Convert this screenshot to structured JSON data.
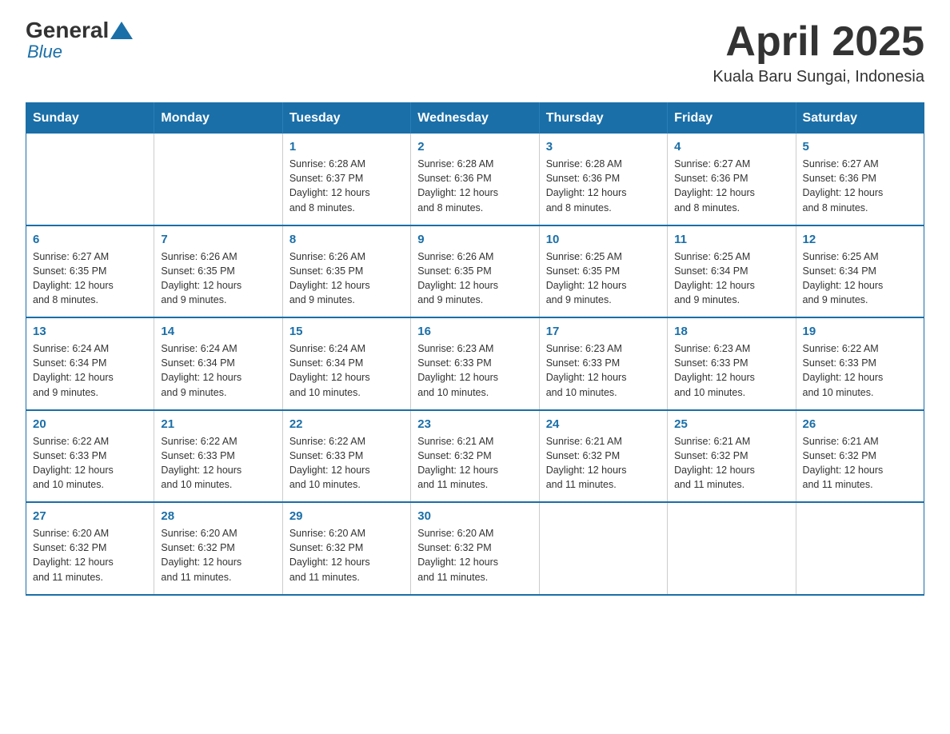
{
  "logo": {
    "general": "General",
    "blue": "Blue"
  },
  "title": "April 2025",
  "subtitle": "Kuala Baru Sungai, Indonesia",
  "weekdays": [
    "Sunday",
    "Monday",
    "Tuesday",
    "Wednesday",
    "Thursday",
    "Friday",
    "Saturday"
  ],
  "weeks": [
    [
      {
        "day": "",
        "info": ""
      },
      {
        "day": "",
        "info": ""
      },
      {
        "day": "1",
        "info": "Sunrise: 6:28 AM\nSunset: 6:37 PM\nDaylight: 12 hours\nand 8 minutes."
      },
      {
        "day": "2",
        "info": "Sunrise: 6:28 AM\nSunset: 6:36 PM\nDaylight: 12 hours\nand 8 minutes."
      },
      {
        "day": "3",
        "info": "Sunrise: 6:28 AM\nSunset: 6:36 PM\nDaylight: 12 hours\nand 8 minutes."
      },
      {
        "day": "4",
        "info": "Sunrise: 6:27 AM\nSunset: 6:36 PM\nDaylight: 12 hours\nand 8 minutes."
      },
      {
        "day": "5",
        "info": "Sunrise: 6:27 AM\nSunset: 6:36 PM\nDaylight: 12 hours\nand 8 minutes."
      }
    ],
    [
      {
        "day": "6",
        "info": "Sunrise: 6:27 AM\nSunset: 6:35 PM\nDaylight: 12 hours\nand 8 minutes."
      },
      {
        "day": "7",
        "info": "Sunrise: 6:26 AM\nSunset: 6:35 PM\nDaylight: 12 hours\nand 9 minutes."
      },
      {
        "day": "8",
        "info": "Sunrise: 6:26 AM\nSunset: 6:35 PM\nDaylight: 12 hours\nand 9 minutes."
      },
      {
        "day": "9",
        "info": "Sunrise: 6:26 AM\nSunset: 6:35 PM\nDaylight: 12 hours\nand 9 minutes."
      },
      {
        "day": "10",
        "info": "Sunrise: 6:25 AM\nSunset: 6:35 PM\nDaylight: 12 hours\nand 9 minutes."
      },
      {
        "day": "11",
        "info": "Sunrise: 6:25 AM\nSunset: 6:34 PM\nDaylight: 12 hours\nand 9 minutes."
      },
      {
        "day": "12",
        "info": "Sunrise: 6:25 AM\nSunset: 6:34 PM\nDaylight: 12 hours\nand 9 minutes."
      }
    ],
    [
      {
        "day": "13",
        "info": "Sunrise: 6:24 AM\nSunset: 6:34 PM\nDaylight: 12 hours\nand 9 minutes."
      },
      {
        "day": "14",
        "info": "Sunrise: 6:24 AM\nSunset: 6:34 PM\nDaylight: 12 hours\nand 9 minutes."
      },
      {
        "day": "15",
        "info": "Sunrise: 6:24 AM\nSunset: 6:34 PM\nDaylight: 12 hours\nand 10 minutes."
      },
      {
        "day": "16",
        "info": "Sunrise: 6:23 AM\nSunset: 6:33 PM\nDaylight: 12 hours\nand 10 minutes."
      },
      {
        "day": "17",
        "info": "Sunrise: 6:23 AM\nSunset: 6:33 PM\nDaylight: 12 hours\nand 10 minutes."
      },
      {
        "day": "18",
        "info": "Sunrise: 6:23 AM\nSunset: 6:33 PM\nDaylight: 12 hours\nand 10 minutes."
      },
      {
        "day": "19",
        "info": "Sunrise: 6:22 AM\nSunset: 6:33 PM\nDaylight: 12 hours\nand 10 minutes."
      }
    ],
    [
      {
        "day": "20",
        "info": "Sunrise: 6:22 AM\nSunset: 6:33 PM\nDaylight: 12 hours\nand 10 minutes."
      },
      {
        "day": "21",
        "info": "Sunrise: 6:22 AM\nSunset: 6:33 PM\nDaylight: 12 hours\nand 10 minutes."
      },
      {
        "day": "22",
        "info": "Sunrise: 6:22 AM\nSunset: 6:33 PM\nDaylight: 12 hours\nand 10 minutes."
      },
      {
        "day": "23",
        "info": "Sunrise: 6:21 AM\nSunset: 6:32 PM\nDaylight: 12 hours\nand 11 minutes."
      },
      {
        "day": "24",
        "info": "Sunrise: 6:21 AM\nSunset: 6:32 PM\nDaylight: 12 hours\nand 11 minutes."
      },
      {
        "day": "25",
        "info": "Sunrise: 6:21 AM\nSunset: 6:32 PM\nDaylight: 12 hours\nand 11 minutes."
      },
      {
        "day": "26",
        "info": "Sunrise: 6:21 AM\nSunset: 6:32 PM\nDaylight: 12 hours\nand 11 minutes."
      }
    ],
    [
      {
        "day": "27",
        "info": "Sunrise: 6:20 AM\nSunset: 6:32 PM\nDaylight: 12 hours\nand 11 minutes."
      },
      {
        "day": "28",
        "info": "Sunrise: 6:20 AM\nSunset: 6:32 PM\nDaylight: 12 hours\nand 11 minutes."
      },
      {
        "day": "29",
        "info": "Sunrise: 6:20 AM\nSunset: 6:32 PM\nDaylight: 12 hours\nand 11 minutes."
      },
      {
        "day": "30",
        "info": "Sunrise: 6:20 AM\nSunset: 6:32 PM\nDaylight: 12 hours\nand 11 minutes."
      },
      {
        "day": "",
        "info": ""
      },
      {
        "day": "",
        "info": ""
      },
      {
        "day": "",
        "info": ""
      }
    ]
  ]
}
